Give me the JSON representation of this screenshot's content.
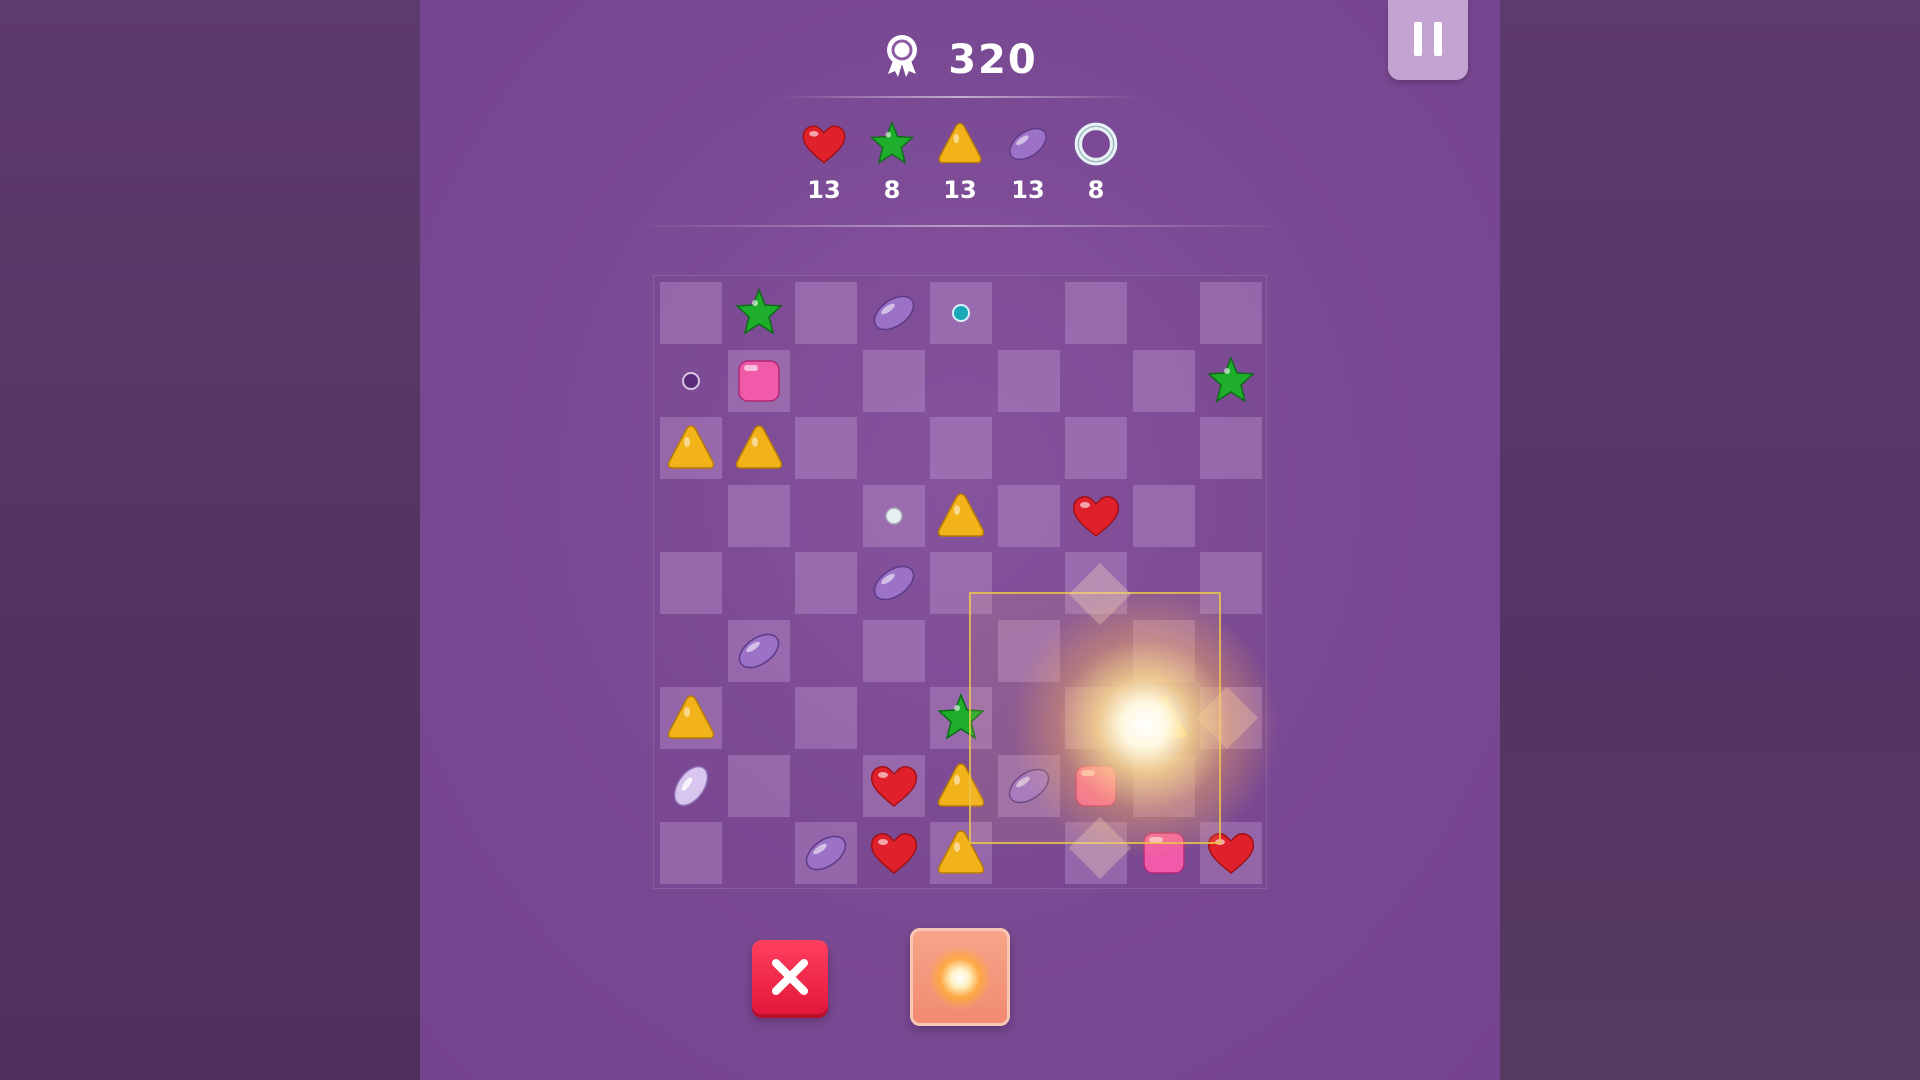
{
  "score": {
    "value": "320",
    "icon": "medal-icon"
  },
  "pause": {
    "icon": "pause-icon"
  },
  "goals": [
    {
      "type": "heart",
      "count": "13"
    },
    {
      "type": "star",
      "count": "8"
    },
    {
      "type": "triangle",
      "count": "13"
    },
    {
      "type": "oval",
      "count": "13"
    },
    {
      "type": "ring",
      "count": "8"
    }
  ],
  "colors": {
    "heart": "#e0202a",
    "star": "#1fae2b",
    "triangle": "#f2b21a",
    "oval": "#9c72c8",
    "square": "#f05aa8",
    "cancel": "#e8203f",
    "booster": "#f29a7f"
  },
  "board": {
    "rows": 9,
    "cols": 9,
    "tokens": [
      [
        "",
        "star",
        "",
        "oval",
        "dot-teal",
        "",
        "",
        "",
        ""
      ],
      [
        "dot-purple",
        "square",
        "",
        "",
        "",
        "",
        "",
        "",
        "star"
      ],
      [
        "triangle",
        "triangle",
        "",
        "",
        "",
        "",
        "",
        "",
        ""
      ],
      [
        "",
        "",
        "",
        "dot-white",
        "triangle",
        "",
        "heart",
        "",
        ""
      ],
      [
        "",
        "",
        "",
        "oval",
        "",
        "",
        "",
        "",
        ""
      ],
      [
        "",
        "oval",
        "",
        "",
        "",
        "",
        "",
        "",
        ""
      ],
      [
        "triangle",
        "",
        "",
        "",
        "star",
        "",
        "",
        "triangle",
        ""
      ],
      [
        "oval-white",
        "",
        "",
        "heart",
        "triangle",
        "oval",
        "square",
        "",
        ""
      ],
      [
        "",
        "",
        "oval",
        "heart",
        "triangle",
        "",
        "",
        "square",
        "heart"
      ]
    ]
  },
  "booster": {
    "icon": "explosion-icon"
  },
  "cancel": {
    "icon": "close-icon"
  }
}
